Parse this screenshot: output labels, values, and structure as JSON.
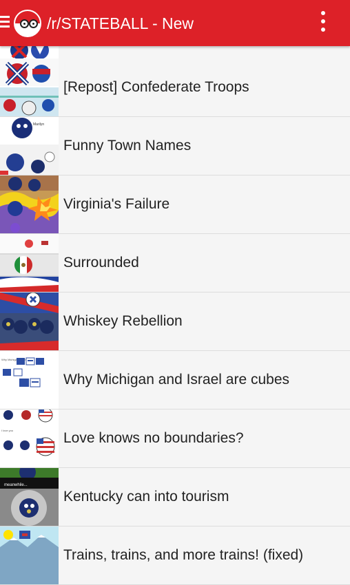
{
  "app_bar": {
    "title": "/r/STATEBALL - New",
    "menu_icon": "hamburger-menu-icon",
    "logo_icon": "polandball-logo-icon",
    "overflow_icon": "more-vertical-icon"
  },
  "colors": {
    "app_bar": "#dd2128",
    "background": "#f5f5f5",
    "text": "#222222",
    "divider": "#dcdcdc"
  },
  "posts": [
    {
      "title": "[Repost] Confederate Troops",
      "thumb": "comic-thumbnail"
    },
    {
      "title": "Funny Town Names",
      "thumb": "comic-thumbnail"
    },
    {
      "title": "Virginia's Failure",
      "thumb": "comic-thumbnail"
    },
    {
      "title": "Surrounded",
      "thumb": "comic-thumbnail"
    },
    {
      "title": "Whiskey Rebellion",
      "thumb": "comic-thumbnail"
    },
    {
      "title": "Why Michigan and Israel are cubes",
      "thumb": "comic-thumbnail"
    },
    {
      "title": "Love knows no boundaries?",
      "thumb": "comic-thumbnail"
    },
    {
      "title": "Kentucky can into tourism",
      "thumb": "comic-thumbnail"
    },
    {
      "title": "Trains, trains, and more trains! (fixed)",
      "thumb": "comic-thumbnail"
    }
  ]
}
